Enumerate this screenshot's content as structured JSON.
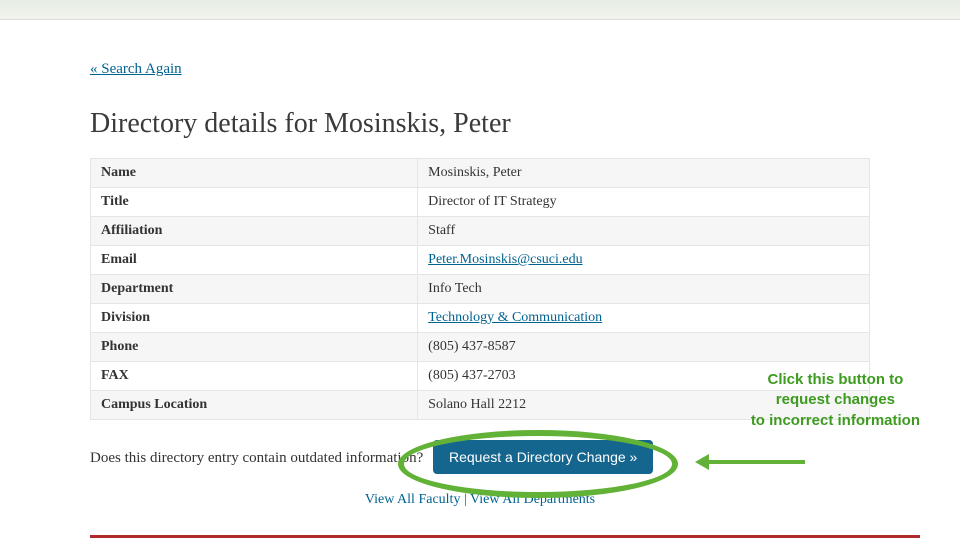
{
  "nav": {
    "search_again_prefix": "« ",
    "search_again": "Search Again"
  },
  "heading": "Directory details for Mosinskis, Peter",
  "rows": {
    "name_label": "Name",
    "name_value": "Mosinskis, Peter",
    "title_label": "Title",
    "title_value": "Director of IT Strategy",
    "affiliation_label": "Affiliation",
    "affiliation_value": "Staff",
    "email_label": "Email",
    "email_value": "Peter.Mosinskis@csuci.edu",
    "department_label": "Department",
    "department_value": "Info Tech",
    "division_label": "Division",
    "division_value": "Technology & Communication",
    "phone_label": "Phone",
    "phone_value": "(805) 437-8587",
    "fax_label": "FAX",
    "fax_value": "(805) 437-2703",
    "campus_label": "Campus Location",
    "campus_value": "Solano Hall 2212"
  },
  "prompt": {
    "text": "Does this directory entry contain outdated information? ",
    "button": "Request a Directory Change »"
  },
  "bottom": {
    "faculty": "View All Faculty",
    "sep": " | ",
    "departments": "View All Departments"
  },
  "annotation": {
    "line1": "Click this button to",
    "line2": "request changes",
    "line3": "to incorrect information"
  }
}
